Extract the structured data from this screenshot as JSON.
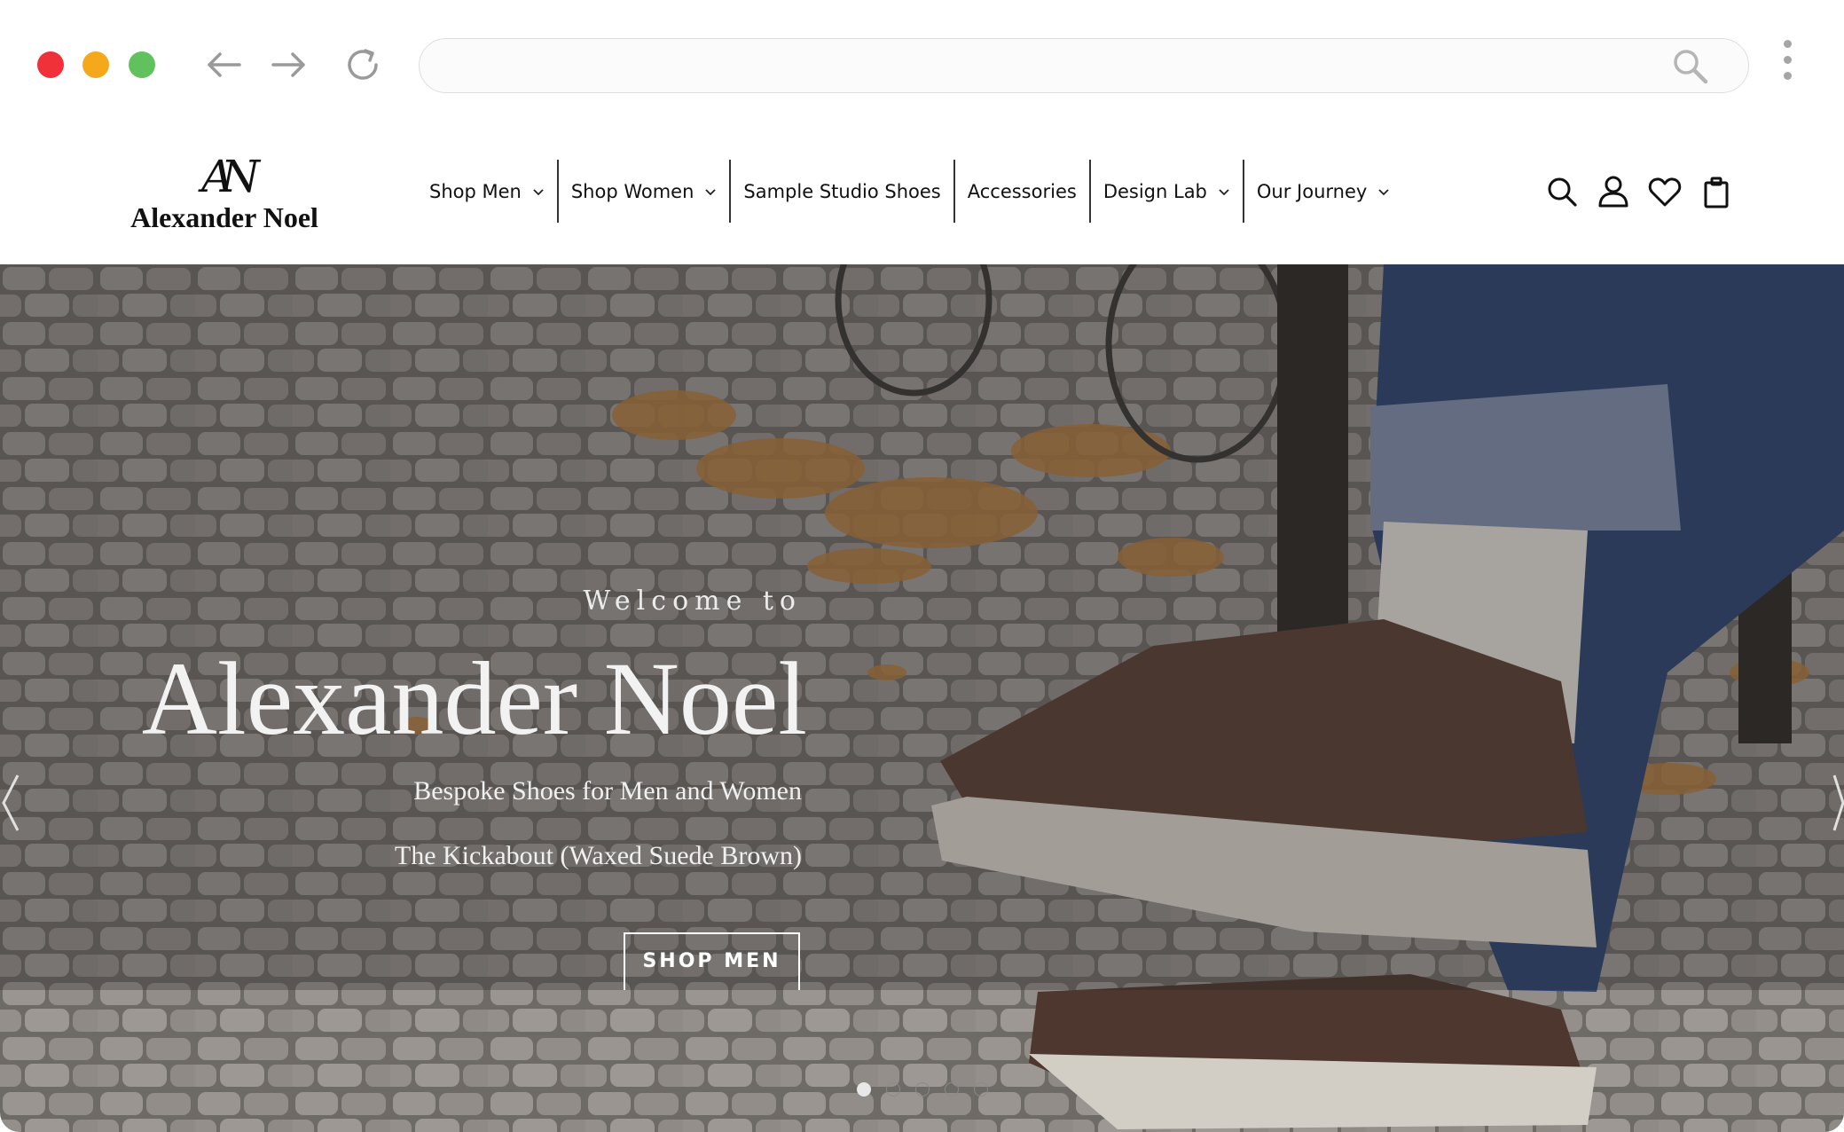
{
  "browser": {
    "url": "",
    "icons": [
      "back-arrow-icon",
      "forward-arrow-icon",
      "reload-icon",
      "search-icon",
      "more-vertical-icon"
    ]
  },
  "site": {
    "logo_mark": "AN",
    "logo_text": "Alexander Noel"
  },
  "nav": {
    "items": [
      {
        "label": "Shop Men",
        "has_dropdown": true
      },
      {
        "label": "Shop Women",
        "has_dropdown": true
      },
      {
        "label": "Sample Studio Shoes",
        "has_dropdown": false
      },
      {
        "label": "Accessories",
        "has_dropdown": false
      },
      {
        "label": "Design Lab",
        "has_dropdown": true
      },
      {
        "label": "Our Journey",
        "has_dropdown": true
      }
    ],
    "icons": [
      "search-icon",
      "account-icon",
      "wishlist-heart-icon",
      "shopping-bag-icon"
    ]
  },
  "hero": {
    "welcome": "Welcome to",
    "title": "Alexander Noel",
    "subtitle": "Bespoke Shoes for Men and Women",
    "product": "The Kickabout (Waxed Suede Brown)",
    "cta": "SHOP MEN",
    "slides_total": 5,
    "active_slide": 1
  },
  "colors": {
    "close": "#f0313a",
    "minimize": "#f6a81c",
    "maximize": "#61c15c",
    "text": "#111111",
    "hero_text": "#f2f2f2"
  }
}
